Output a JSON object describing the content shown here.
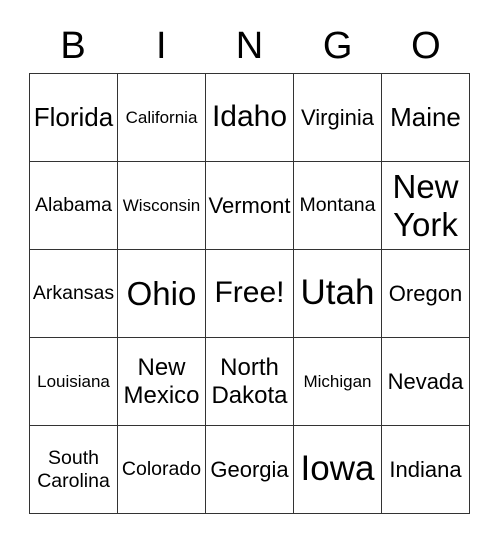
{
  "header": {
    "letters": [
      "B",
      "I",
      "N",
      "G",
      "O"
    ]
  },
  "card": {
    "rows": [
      [
        {
          "text": "Florida",
          "size": "lg"
        },
        {
          "text": "California",
          "size": "xs"
        },
        {
          "text": "Idaho",
          "size": "xl"
        },
        {
          "text": "Virginia",
          "size": "md"
        },
        {
          "text": "Maine",
          "size": "lg"
        }
      ],
      [
        {
          "text": "Alabama",
          "size": "sm"
        },
        {
          "text": "Wisconsin",
          "size": "xs"
        },
        {
          "text": "Vermont",
          "size": "md"
        },
        {
          "text": "Montana",
          "size": "sm"
        },
        {
          "text": "New York",
          "size": "xxl"
        }
      ],
      [
        {
          "text": "Arkansas",
          "size": "sm"
        },
        {
          "text": "Ohio",
          "size": "xxl"
        },
        {
          "text": "Free!",
          "size": "xl"
        },
        {
          "text": "Utah",
          "size": "xxxl"
        },
        {
          "text": "Oregon",
          "size": "md"
        }
      ],
      [
        {
          "text": "Louisiana",
          "size": "xs"
        },
        {
          "text": "New Mexico",
          "size": "ml"
        },
        {
          "text": "North Dakota",
          "size": "ml"
        },
        {
          "text": "Michigan",
          "size": "xs"
        },
        {
          "text": "Nevada",
          "size": "md"
        }
      ],
      [
        {
          "text": "South Carolina",
          "size": "sm"
        },
        {
          "text": "Colorado",
          "size": "sm"
        },
        {
          "text": "Georgia",
          "size": "md"
        },
        {
          "text": "Iowa",
          "size": "xxxl"
        },
        {
          "text": "Indiana",
          "size": "md"
        }
      ]
    ],
    "free_space": "Free!"
  }
}
